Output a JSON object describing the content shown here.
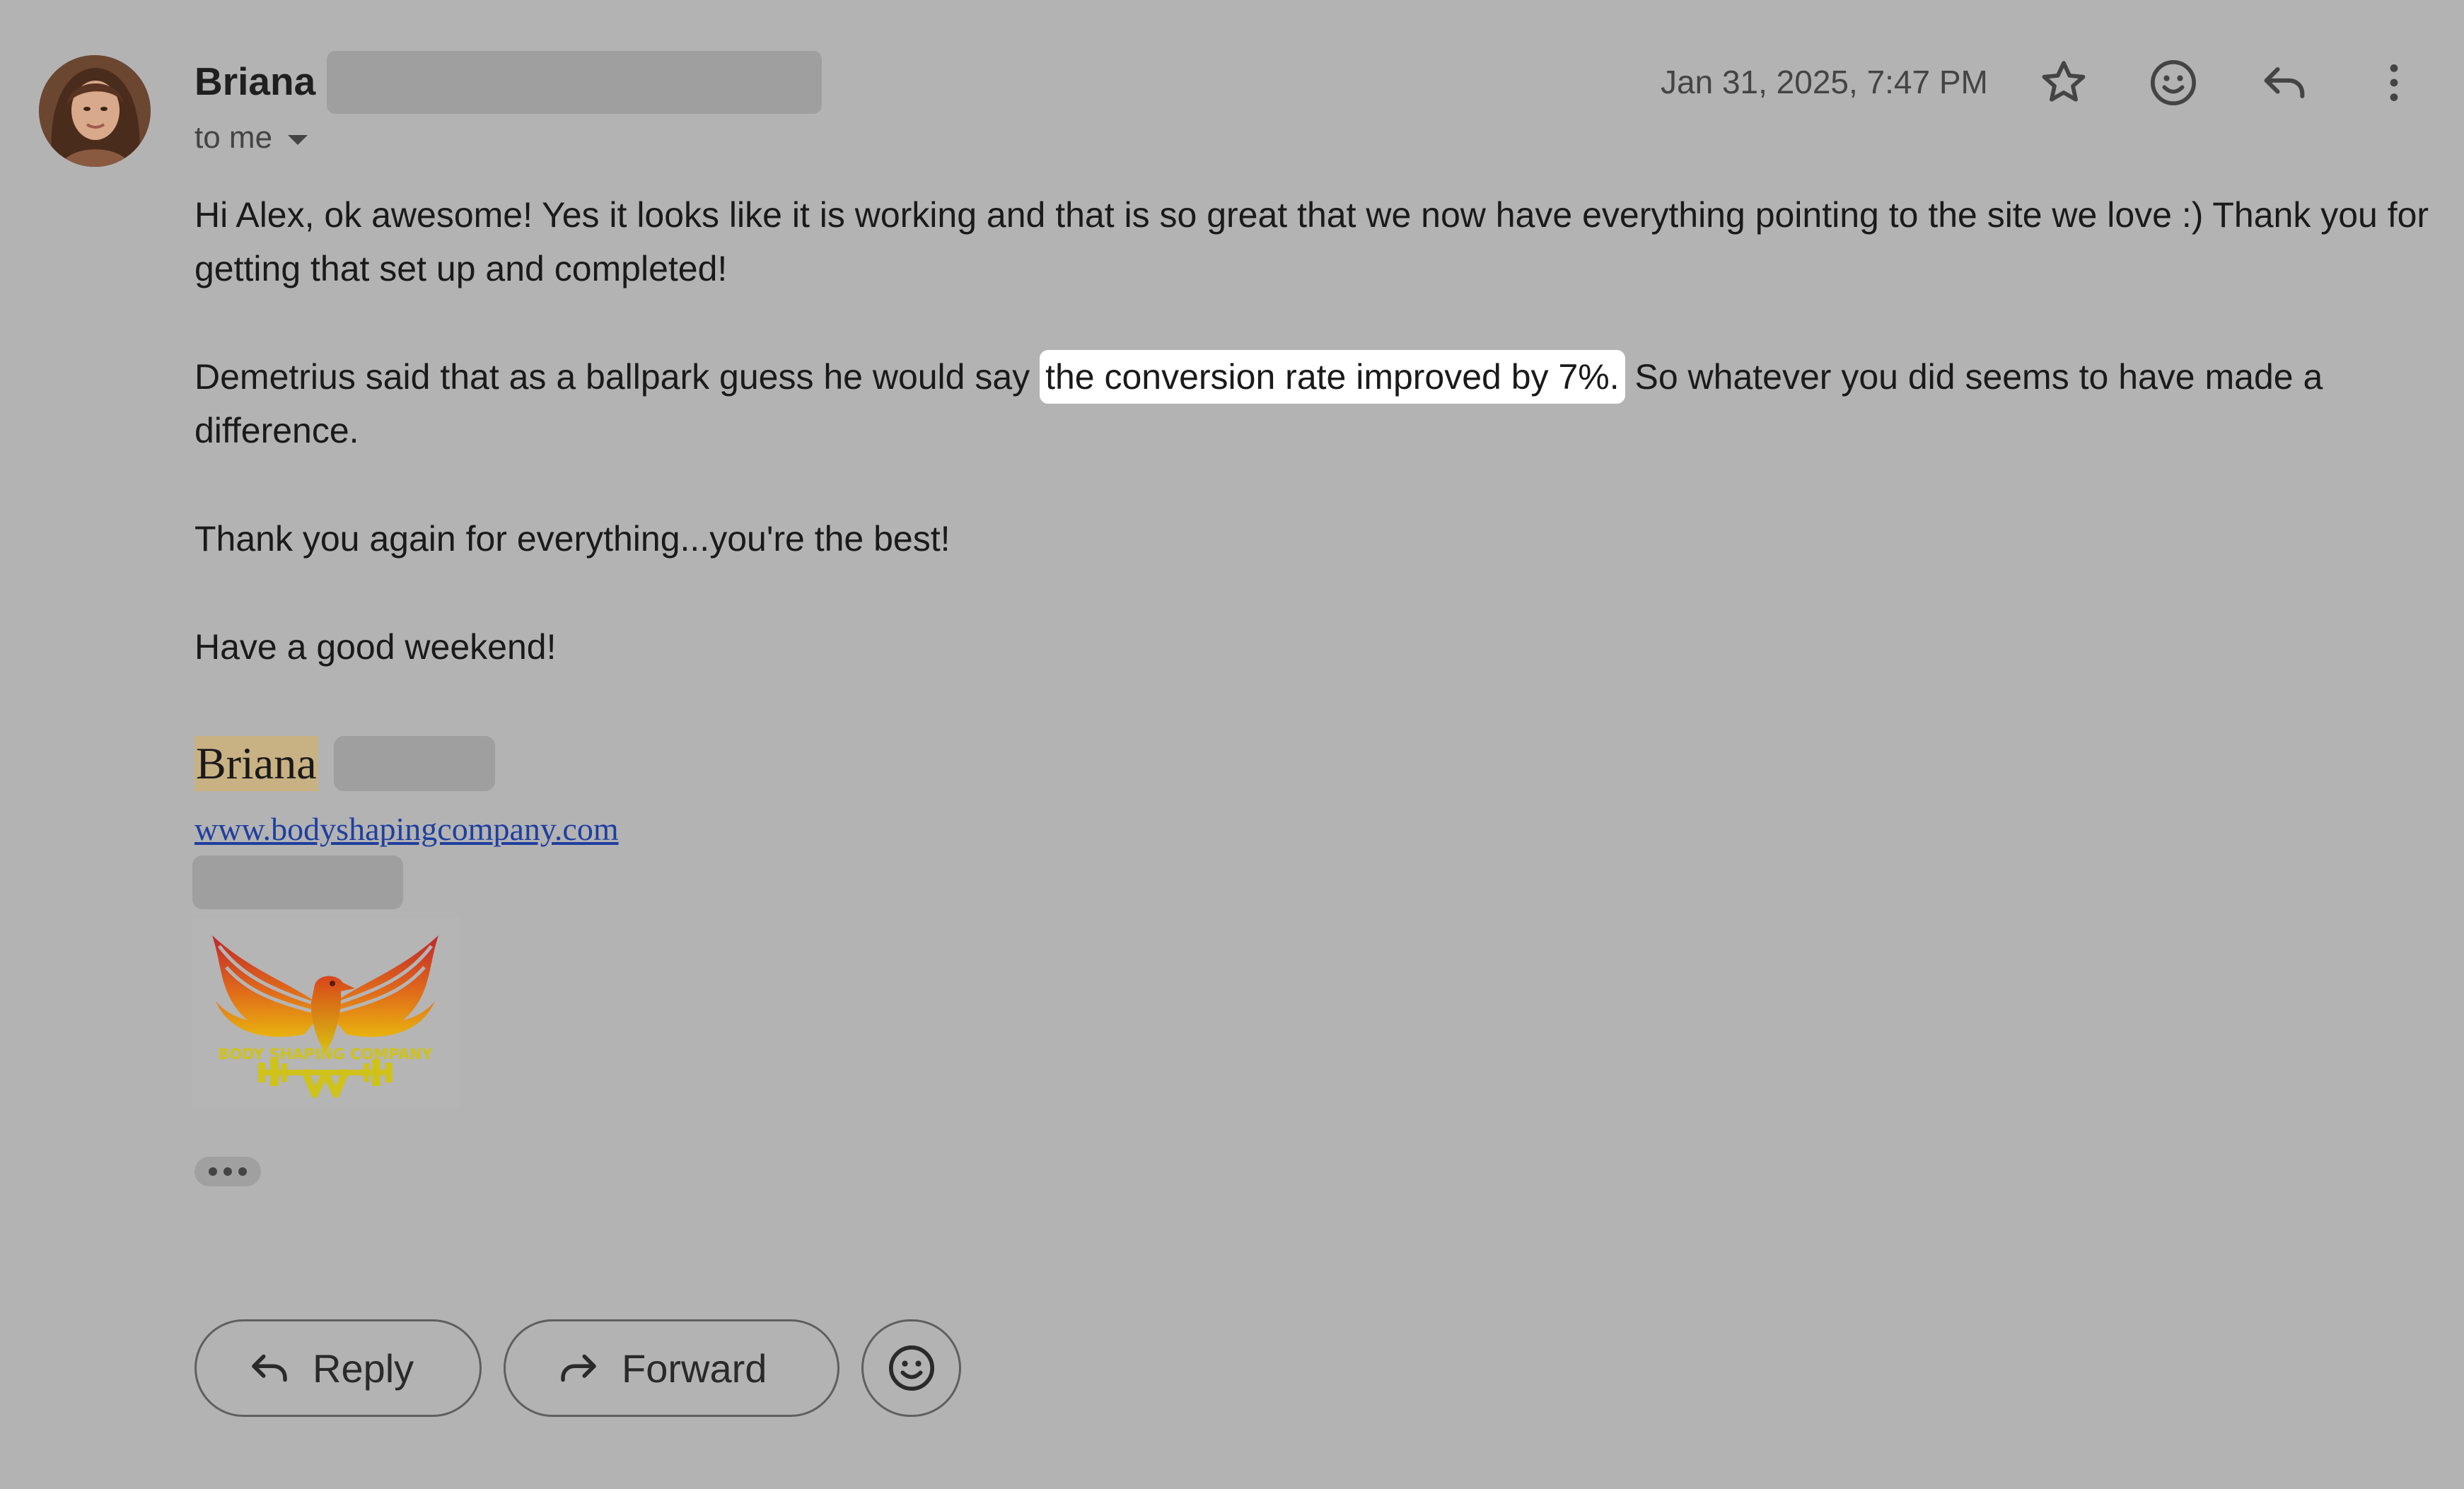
{
  "header": {
    "sender_name": "Briana",
    "recipient": "to me",
    "timestamp": "Jan 31, 2025, 7:47 PM"
  },
  "body": {
    "p1": "Hi Alex, ok awesome! Yes it looks like it is working and that is so great that we now have everything pointing to the site we love :) Thank you for getting that set up and completed!",
    "p2_before": "Demetrius said that as a ballpark guess he would say ",
    "p2_highlight": "the conversion rate improved by 7%.",
    "p2_after": " So whatever you did seems to have made a difference.",
    "p3": "Thank you again for everything...you're the best!",
    "p4": "Have a good weekend!"
  },
  "signature": {
    "name": "Briana",
    "website": "www.bodyshapingcompany.com",
    "logo_text": "BODY SHAPING COMPANY"
  },
  "footer": {
    "reply_label": "Reply",
    "forward_label": "Forward"
  },
  "icons": {
    "star": "star-icon",
    "emoji": "emoji-icon",
    "reply": "reply-icon",
    "more": "more-vert-icon",
    "forward": "forward-icon"
  },
  "colors": {
    "background": "#b3b3b3",
    "highlight": "#ffffff",
    "signature_name_highlight": "#c8b183",
    "link": "#1f3f9f"
  }
}
